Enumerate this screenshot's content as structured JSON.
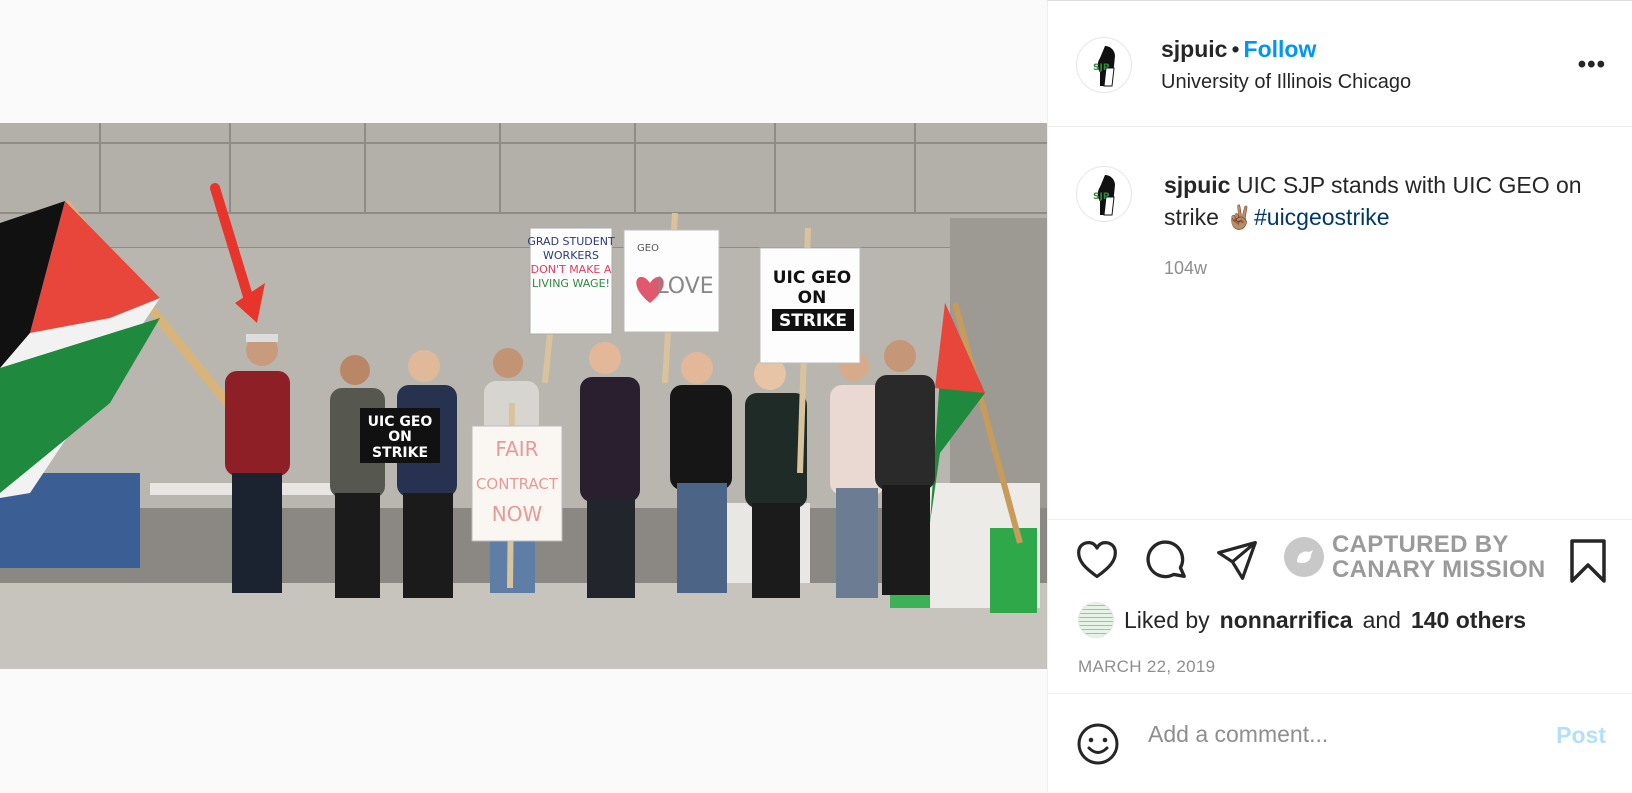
{
  "post": {
    "username": "sjpuic",
    "follow_label": "Follow",
    "separator": "•",
    "location": "University of Illinois Chicago",
    "more_label": "•••",
    "caption_text": "UIC SJP stands with UIC GEO on strike ✌🏽",
    "hashtag": "#uicgeostrike",
    "age": "104w",
    "canary_line1": "CAPTURED BY",
    "canary_line2": "CANARY MISSION",
    "likes_prefix": "Liked by",
    "liked_by_user": "nonnarrifica",
    "likes_and": "and",
    "likes_others": "140 others",
    "date": "MARCH 22, 2019",
    "comment_placeholder": "Add a comment...",
    "post_label": "Post",
    "avatar_text": "SJP"
  },
  "photo": {
    "signs": {
      "uic_geo": "UIC GEO",
      "on": "ON",
      "strike": "STRIKE",
      "fair": "FAIR",
      "contract": "CONTRACT",
      "now": "NOW",
      "geo": "GEO",
      "love": "LOVE",
      "grad1": "GRAD STUDENT",
      "grad2": "WORKERS",
      "grad3": "DON'T MAKE A",
      "grad4": "LIVING WAGE!"
    }
  },
  "colors": {
    "accent": "#0095f6",
    "hashtag": "#00376b",
    "muted": "#8e8e8e",
    "post_disabled": "#b2dffc",
    "flag_red": "#e8463b",
    "flag_green": "#1f8a3d"
  }
}
